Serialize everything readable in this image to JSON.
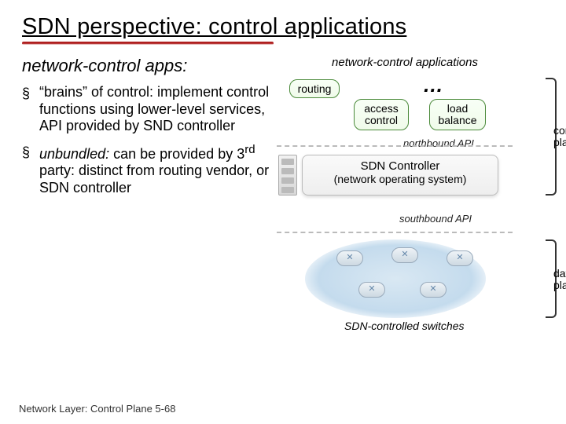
{
  "title": "SDN perspective: control applications",
  "subhead": "network-control apps:",
  "bullets": [
    {
      "html": "“brains” of control: implement control functions using lower-level services, API provided by SND controller"
    },
    {
      "html": "<span class='em'>unbundled:</span> can be provided by 3<sup>rd</sup> party: distinct from routing vendor, or SDN controller"
    }
  ],
  "diagram": {
    "apps_label": "network-control applications",
    "routing": "routing",
    "access": "access control",
    "load": "load balance",
    "ellipsis": "…",
    "northbound": "northbound API",
    "controller_title": "SDN Controller",
    "controller_sub": "(network operating system)",
    "southbound": "southbound API",
    "switches_label": "SDN-controlled switches",
    "control_plane": "control plane",
    "data_plane": "data plane"
  },
  "footer": "Network Layer: Control Plane  5-68"
}
